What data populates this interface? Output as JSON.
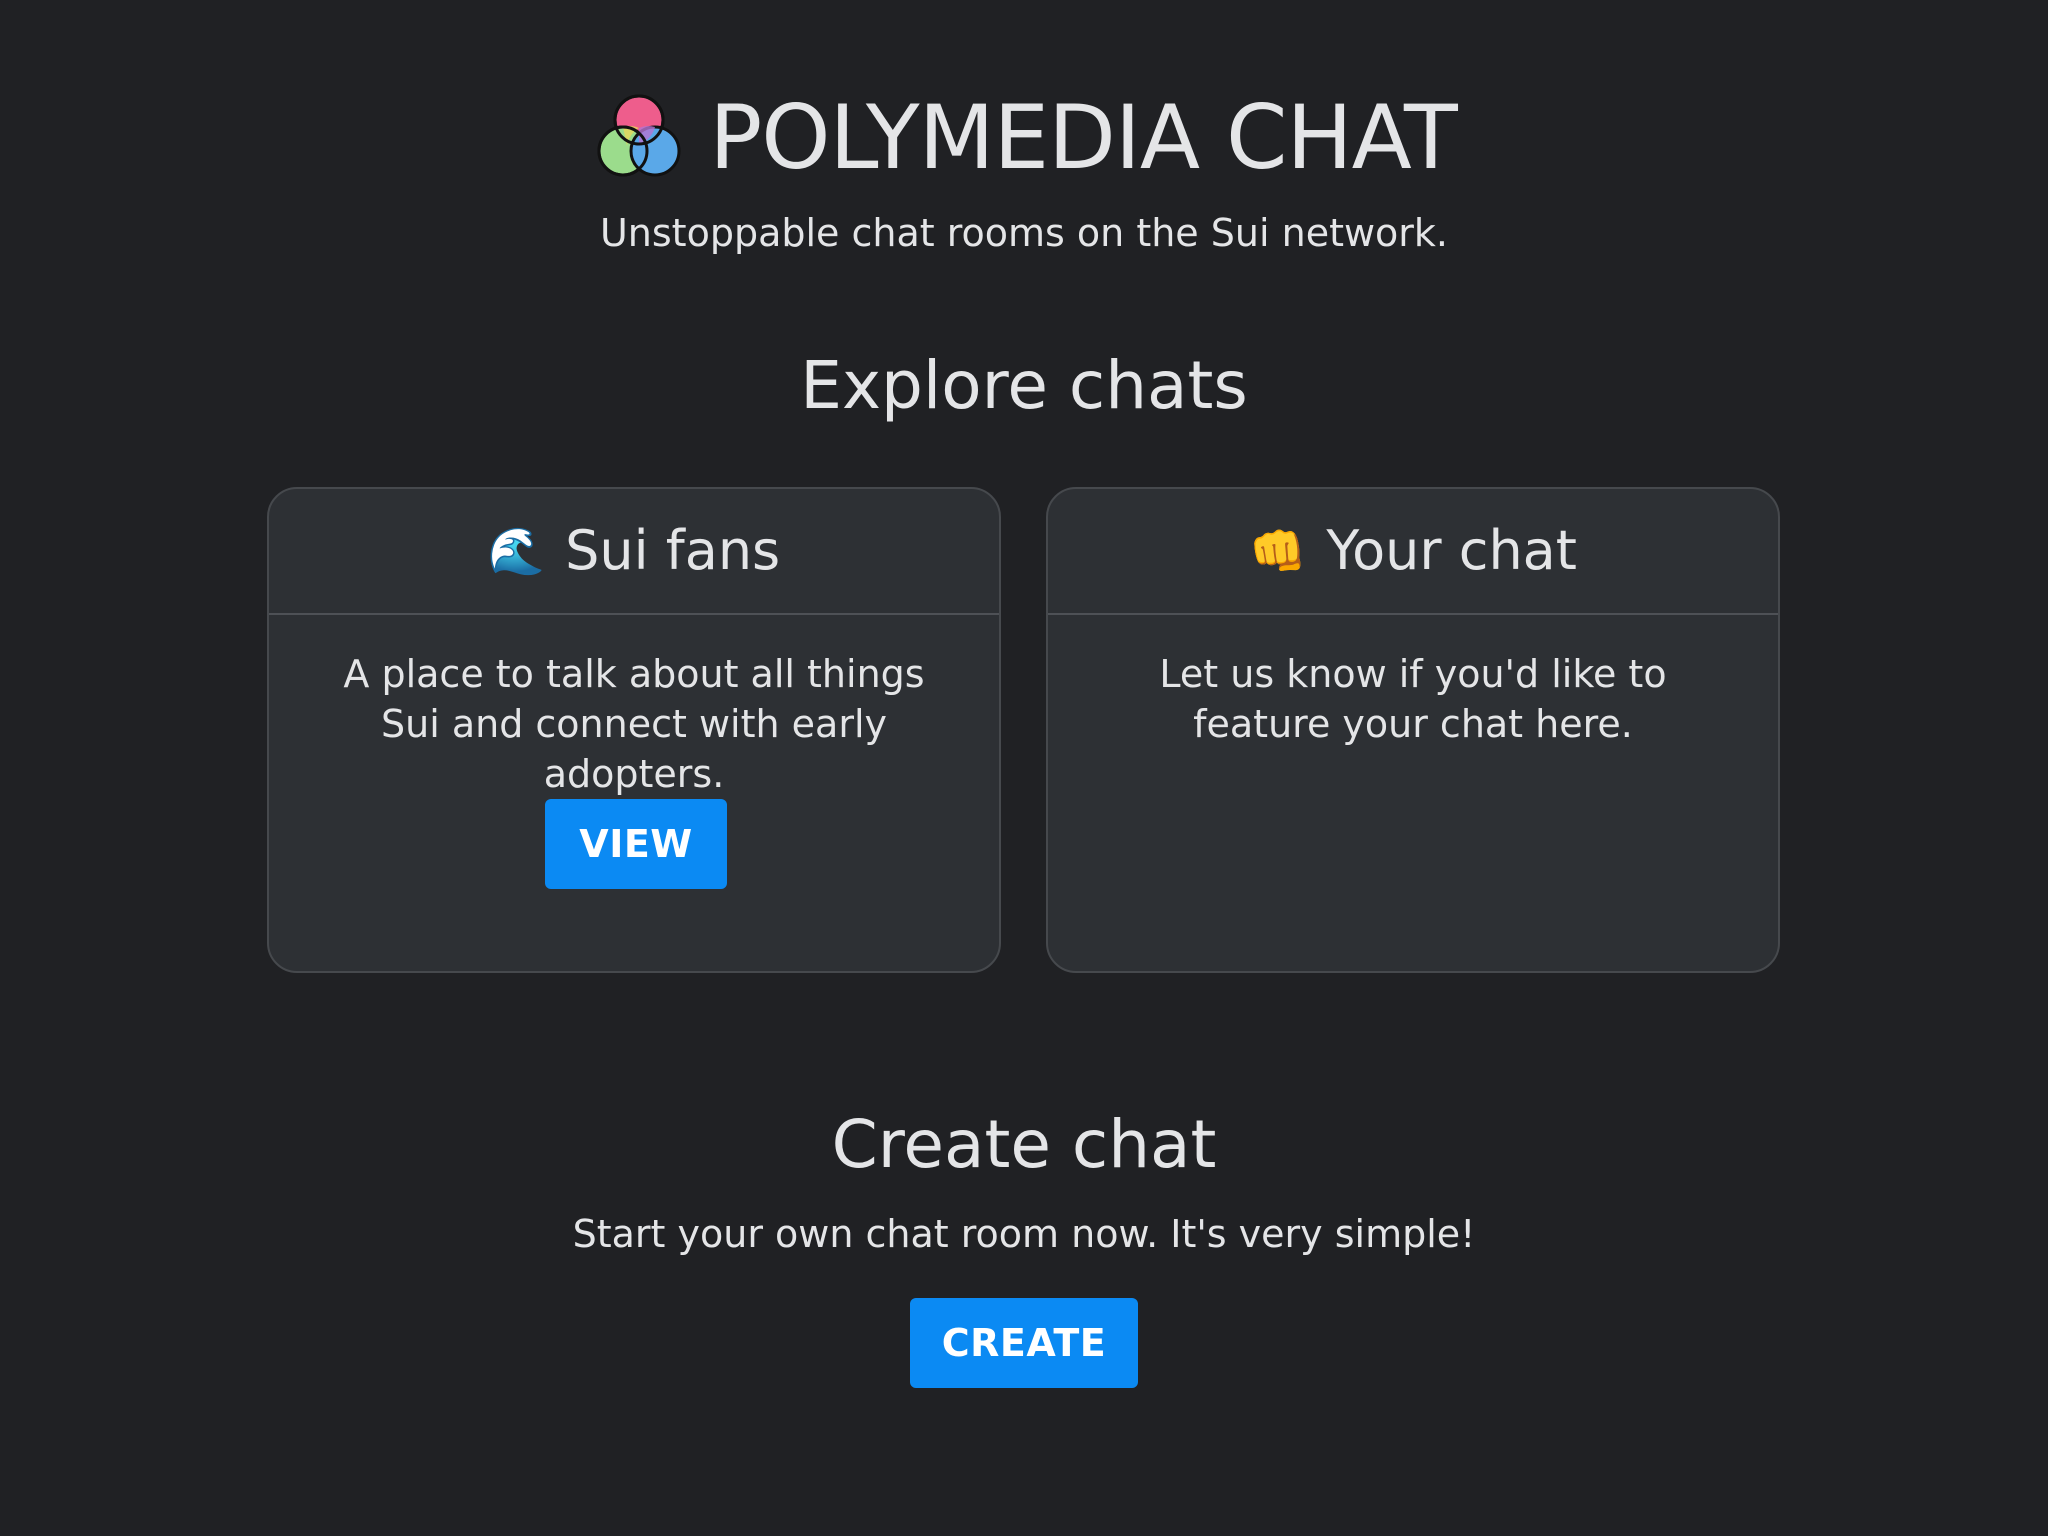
{
  "header": {
    "logo_icon": "polymedia-venn-logo-icon",
    "title": "POLYMEDIA CHAT",
    "tagline": "Unstoppable chat rooms on the Sui network."
  },
  "explore": {
    "title": "Explore chats",
    "cards": [
      {
        "emoji": "🌊",
        "emoji_icon": "wave-icon",
        "title": "Sui fans",
        "description": "A place to talk about all things Sui and connect with early adopters.",
        "button_label": "VIEW"
      },
      {
        "emoji": "👊",
        "emoji_icon": "fist-icon",
        "title": "Your chat",
        "description": "Let us know if you'd like to feature your chat here."
      }
    ]
  },
  "create": {
    "title": "Create chat",
    "description": "Start your own chat room now. It's very simple!",
    "button_label": "CREATE"
  },
  "colors": {
    "background": "#202124",
    "card_background": "#2d3034",
    "accent": "#0b8af3",
    "text": "#e4e5e7"
  }
}
